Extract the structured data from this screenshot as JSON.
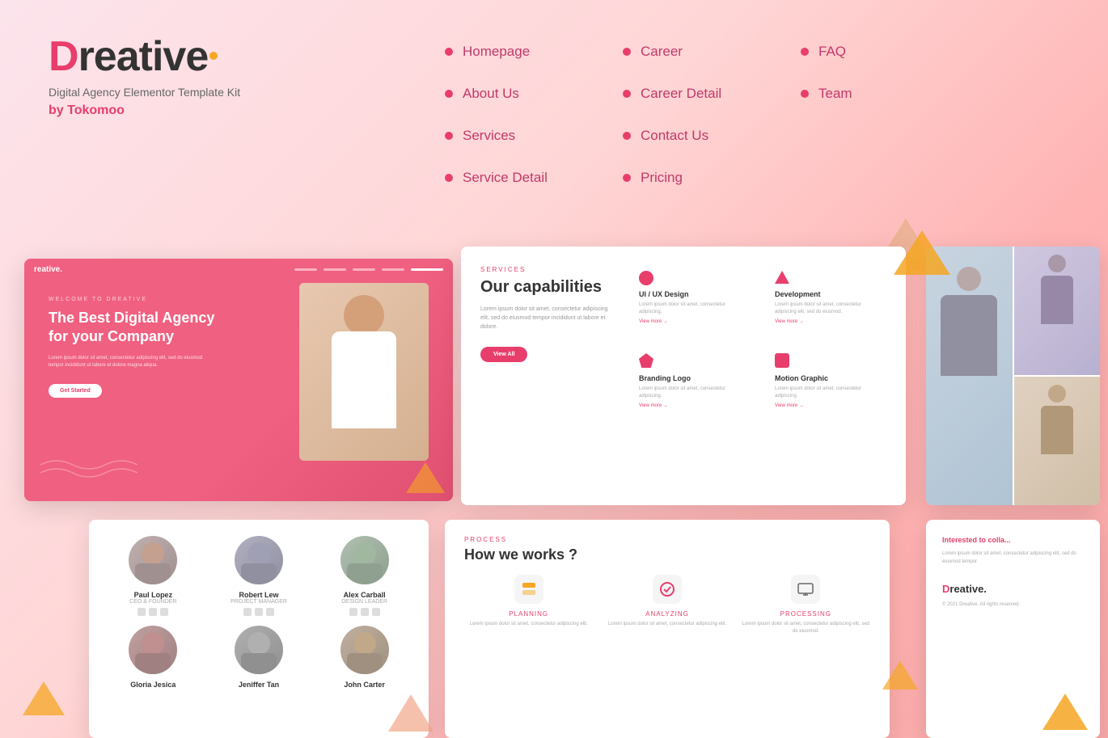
{
  "brand": {
    "name_prefix": "D",
    "name_suffix": "reative",
    "dot": "•",
    "tagline": "Digital Agency Elementor Template Kit",
    "author": "by Tokomoo"
  },
  "nav": {
    "col1": [
      {
        "label": "Homepage"
      },
      {
        "label": "About Us"
      },
      {
        "label": "Services"
      },
      {
        "label": "Service Detail"
      }
    ],
    "col2": [
      {
        "label": "Career"
      },
      {
        "label": "Career Detail"
      },
      {
        "label": "Contact Us"
      },
      {
        "label": "Pricing"
      }
    ],
    "col3": [
      {
        "label": "FAQ"
      },
      {
        "label": "Team"
      }
    ]
  },
  "hero": {
    "small_label": "WELCOME TO DREATIVE",
    "title": "The Best Digital Agency\nfor your Company",
    "desc": "Lorem ipsum dolor sit amet, consectetur adipiscing elit, sed do eiusmod tempor incididunt ut labore et dolore magna aliqua.",
    "button": "Get Started"
  },
  "services_section": {
    "label": "SERVICES",
    "title": "Our capabilities",
    "desc": "Lorem ipsum dolor sit amet, consectetur adipiscing elit, sed do eiusmod tempor incididunt ut labore et dolore.",
    "button": "View All",
    "items": [
      {
        "name": "UI / UX Design",
        "desc": "Lorem ipsum dolor sit amet, consectetur adipiscing.",
        "link": "View more →"
      },
      {
        "name": "Development",
        "desc": "Lorem ipsum dolor sit amet, consectetur adipiscing elit, sed do eiusmod.",
        "link": "View more →"
      },
      {
        "name": "Branding Logo",
        "desc": "Lorem ipsum dolor sit amet, consectetur adipiscing.",
        "link": "View more →"
      },
      {
        "name": "Motion Graphic",
        "desc": "Lorem ipsum dolor sit amet, consectetur adipiscing.",
        "link": "View more →"
      }
    ]
  },
  "process_section": {
    "label": "PROCESS",
    "title": "How we works ?",
    "steps": [
      {
        "label": "PLANNING",
        "desc": "Lorem ipsum dolor sit amet, consectetur adipiscing elit."
      },
      {
        "label": "ANALYZING",
        "desc": "Lorem ipsum dolor sit amet, consectetur adipiscing elit."
      },
      {
        "label": "PROCESSING",
        "desc": "Lorem ipsum dolor sit amet, consectetur adipiscing elit, sed do eiusmod."
      }
    ]
  },
  "team_section": {
    "members": [
      {
        "name": "Paul Lopez",
        "role": "CEO & FOUNDER"
      },
      {
        "name": "Robert Lew",
        "role": "PROJECT MANAGER"
      },
      {
        "name": "Alex Carball",
        "role": "DESIGN LEADER"
      },
      {
        "name": "Gloria Jesica",
        "role": ""
      },
      {
        "name": "Jeniffer Tan",
        "role": ""
      },
      {
        "name": "John Carter",
        "role": ""
      }
    ]
  },
  "contact_section": {
    "brand_d": "D",
    "brand_suffix": "reative.",
    "tagline": "Interested to colla...",
    "desc": "Lorem ipsum dolor sit amet, consectetur adipiscing elit, sed do eiusmod tempor.",
    "copyright": "© 2021 Dreative. All rights reserved."
  },
  "colors": {
    "primary": "#e83e6c",
    "accent": "#f5a623",
    "bg_gradient_start": "#fce4ec",
    "bg_gradient_end": "#ffb3b3"
  }
}
